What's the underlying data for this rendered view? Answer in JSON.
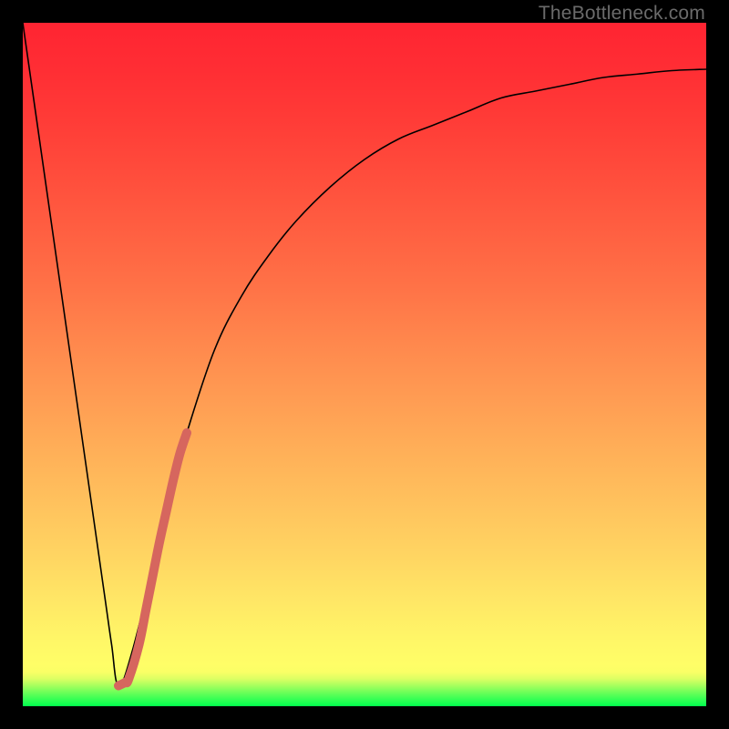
{
  "watermark": "TheBottleneck.com",
  "chart_data": {
    "type": "line",
    "title": "",
    "xlabel": "",
    "ylabel": "",
    "xlim": [
      0,
      100
    ],
    "ylim": [
      0,
      100
    ],
    "grid": false,
    "legend": false,
    "axes_visible": false,
    "background_gradient": {
      "orientation": "vertical",
      "stops": [
        {
          "pos": 0,
          "color": "#ff2432"
        },
        {
          "pos": 50,
          "color": "#ff884d"
        },
        {
          "pos": 93,
          "color": "#fffe67"
        },
        {
          "pos": 100,
          "color": "#00ff4e"
        }
      ]
    },
    "series": [
      {
        "name": "bottleneck-curve",
        "color": "#000000",
        "stroke_width": 1.6,
        "x": [
          0,
          5,
          10,
          12,
          13,
          14,
          16,
          20,
          23,
          24,
          28,
          32,
          36,
          40,
          45,
          50,
          55,
          60,
          65,
          70,
          75,
          80,
          85,
          90,
          95,
          100
        ],
        "y": [
          100,
          65,
          30,
          16,
          9,
          3,
          8,
          24,
          36,
          40,
          52,
          60,
          66,
          71,
          76,
          80,
          83,
          85,
          87,
          89,
          90,
          91,
          92,
          92.5,
          93,
          93.2
        ]
      },
      {
        "name": "highlight-segment",
        "color": "#d6665e",
        "stroke_width": 10,
        "linecap": "round",
        "x": [
          14.0,
          15.0,
          15.5,
          17.0,
          18.0,
          19.0,
          20.0,
          21.0,
          22.0,
          23.0,
          24.0
        ],
        "y": [
          3.0,
          3.5,
          4.0,
          9.0,
          14.0,
          19.0,
          24.0,
          28.5,
          33.0,
          37.0,
          40.0
        ]
      }
    ]
  }
}
